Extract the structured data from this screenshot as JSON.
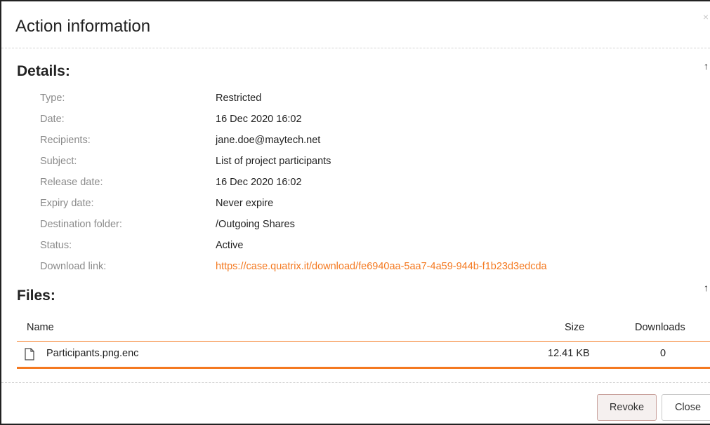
{
  "dialog": {
    "title": "Action information",
    "close_glyph": "×"
  },
  "details": {
    "heading": "Details:",
    "collapse_glyph": "↑",
    "rows": [
      {
        "label": "Type:",
        "value": "Restricted"
      },
      {
        "label": "Date:",
        "value": "16 Dec 2020 16:02"
      },
      {
        "label": "Recipients:",
        "value": "jane.doe@maytech.net"
      },
      {
        "label": "Subject:",
        "value": "List of project participants"
      },
      {
        "label": "Release date:",
        "value": "16 Dec 2020 16:02"
      },
      {
        "label": "Expiry date:",
        "value": "Never expire"
      },
      {
        "label": "Destination folder:",
        "value": "/Outgoing Shares"
      },
      {
        "label": "Status:",
        "value": "Active"
      },
      {
        "label": "Download link:",
        "value": "https://case.quatrix.it/download/fe6940aa-5aa7-4a59-944b-f1b23d3edcda"
      }
    ]
  },
  "files": {
    "heading": "Files:",
    "collapse_glyph": "↑",
    "columns": {
      "name": "Name",
      "size": "Size",
      "downloads": "Downloads"
    },
    "rows": [
      {
        "icon": "file-icon",
        "name": "Participants.png.enc",
        "size": "12.41 KB",
        "downloads": "0"
      }
    ]
  },
  "footer": {
    "revoke_label": "Revoke",
    "close_label": "Close"
  },
  "colors": {
    "accent": "#f47920",
    "label_gray": "#8a8a8a"
  }
}
